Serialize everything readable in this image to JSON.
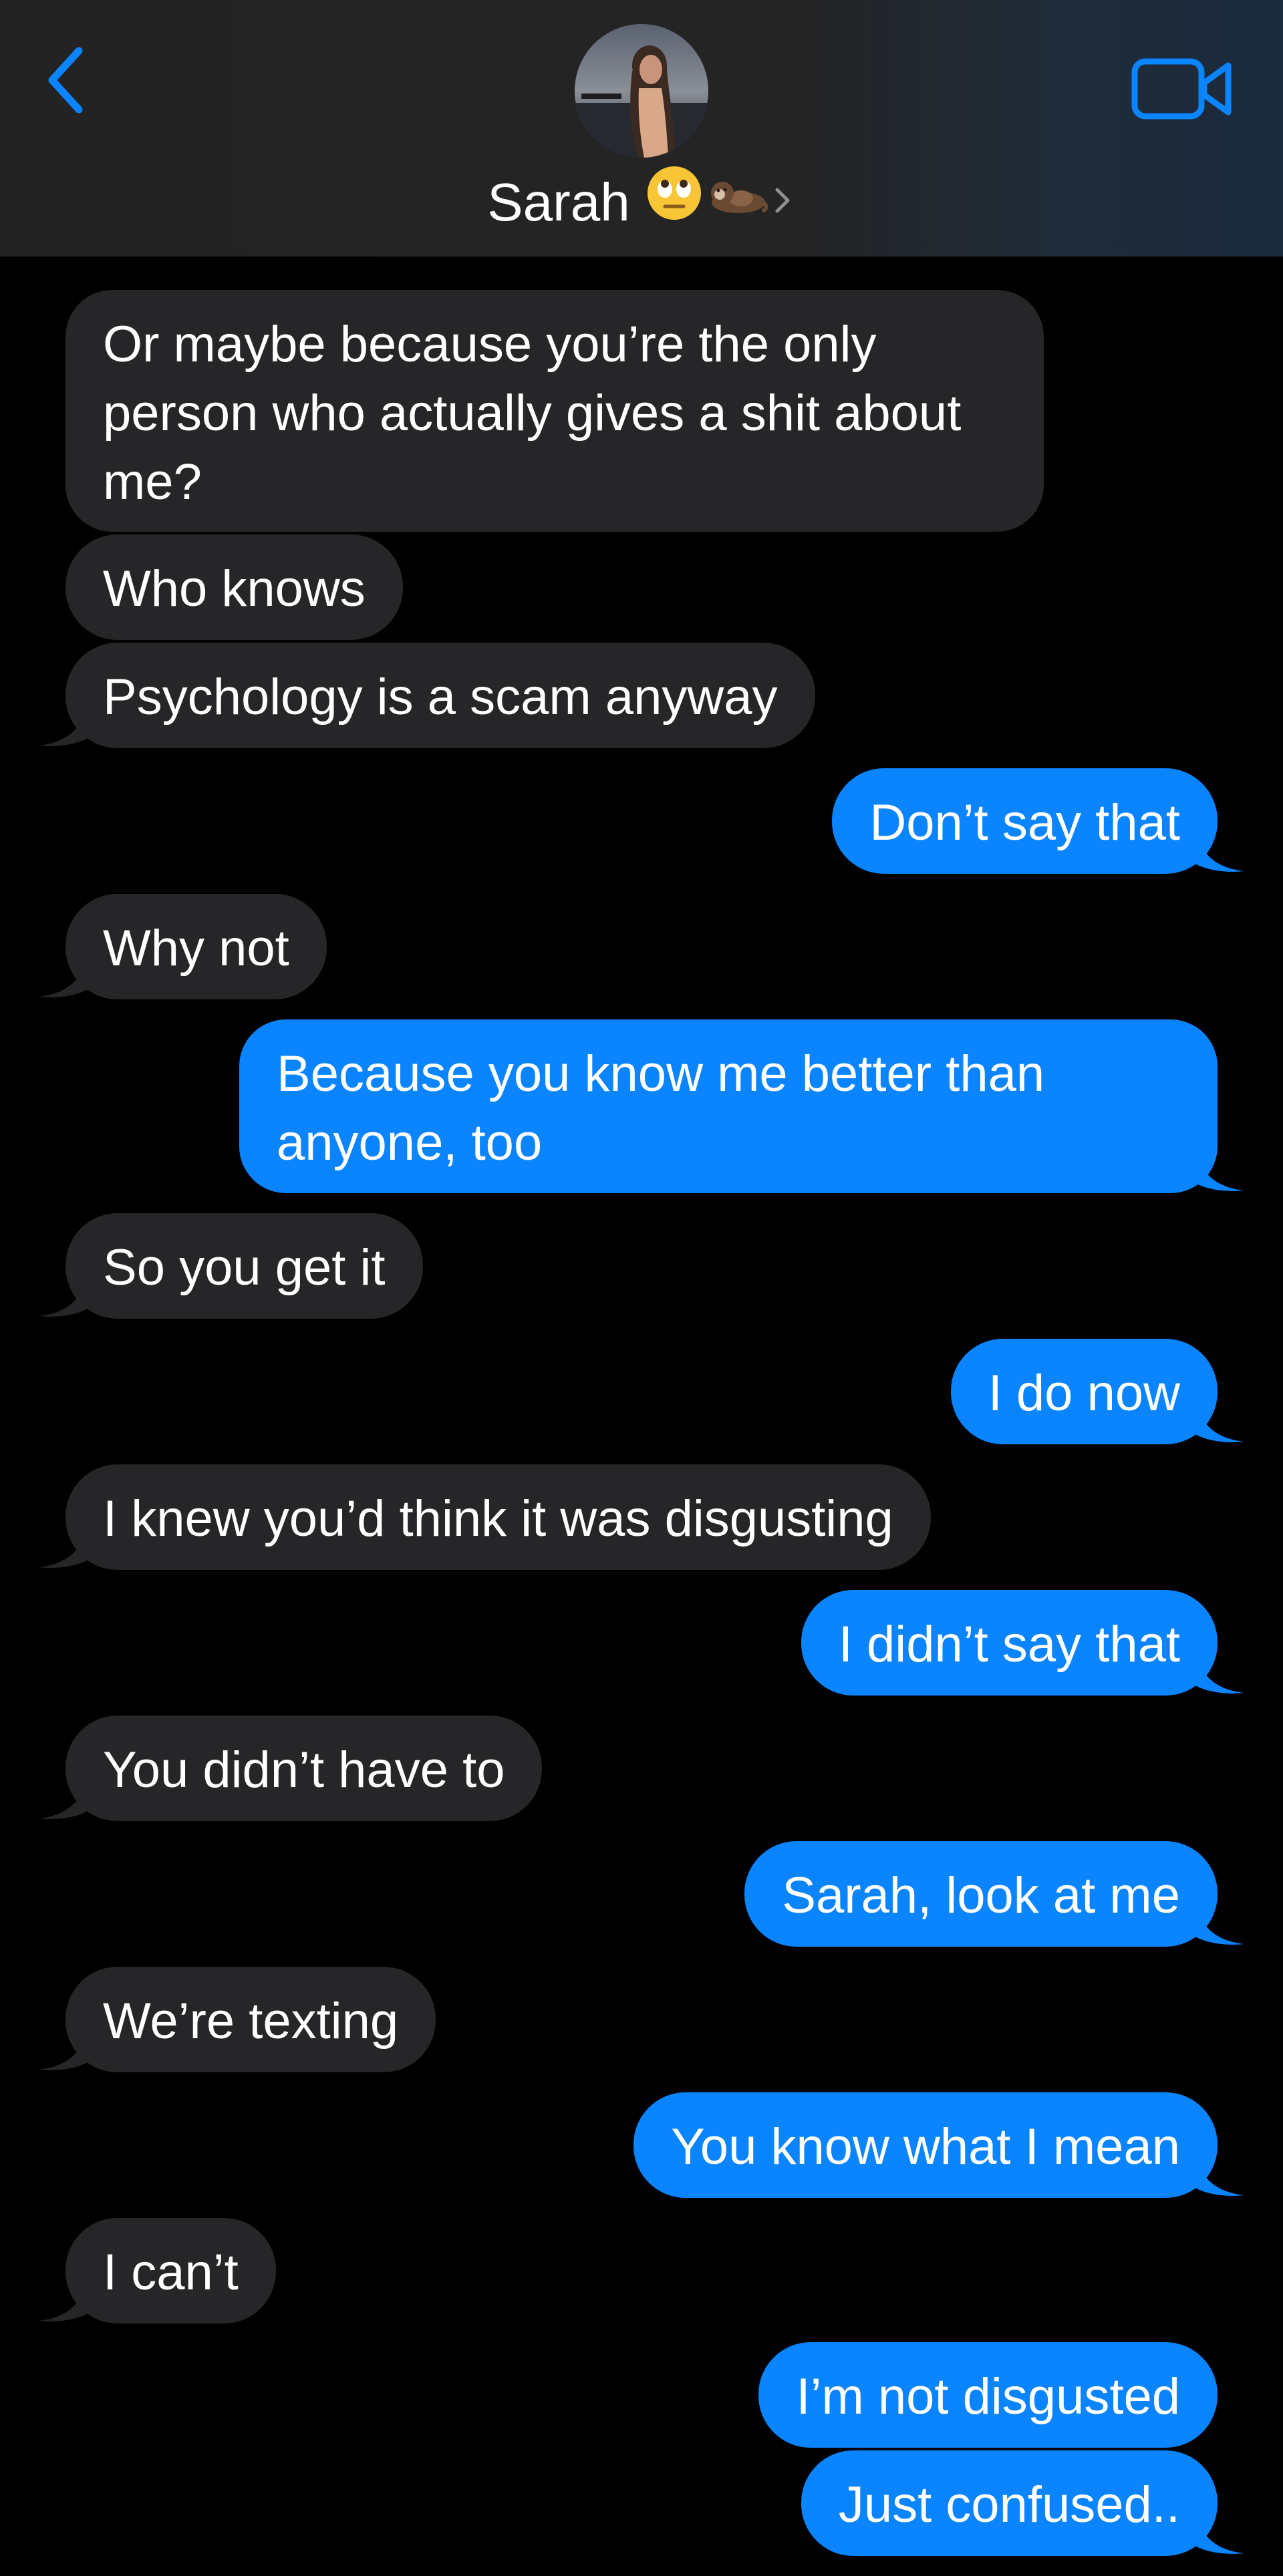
{
  "header": {
    "contact_name": "Sarah",
    "back_icon": "chevron-left-icon",
    "video_icon": "video-camera-icon",
    "name_emojis": [
      "face-with-rolling-eyes",
      "otter"
    ],
    "accent_color": "#0a84ff",
    "background_color": "#242424"
  },
  "colors": {
    "sent_bubble": "#0a84ff",
    "received_bubble": "#262628",
    "background": "#000000",
    "text": "#ffffff"
  },
  "messages": [
    {
      "from": "them",
      "text": "Or maybe because you’re the only person who actually gives a shit about me?"
    },
    {
      "from": "them",
      "text": "Who knows"
    },
    {
      "from": "them",
      "text": "Psychology is a scam anyway"
    },
    {
      "from": "me",
      "text": "Don’t say that"
    },
    {
      "from": "them",
      "text": "Why not"
    },
    {
      "from": "me",
      "text": "Because you know me better than anyone, too"
    },
    {
      "from": "them",
      "text": "So you get it"
    },
    {
      "from": "me",
      "text": "I do now"
    },
    {
      "from": "them",
      "text": "I knew you’d think it was disgusting"
    },
    {
      "from": "me",
      "text": "I didn’t say that"
    },
    {
      "from": "them",
      "text": "You didn’t have to"
    },
    {
      "from": "me",
      "text": "Sarah, look at me"
    },
    {
      "from": "them",
      "text": "We’re texting"
    },
    {
      "from": "me",
      "text": "You know what I mean"
    },
    {
      "from": "them",
      "text": "I can’t"
    },
    {
      "from": "me",
      "text": "I’m not disgusted"
    },
    {
      "from": "me",
      "text": "Just confused.."
    }
  ]
}
